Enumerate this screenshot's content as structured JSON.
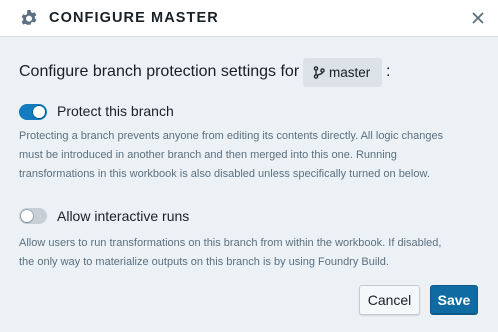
{
  "header": {
    "title": "CONFIGURE MASTER",
    "icon": "gear-icon",
    "close_icon": "close-icon"
  },
  "heading": {
    "text": "Configure branch protection settings for",
    "branch": "master",
    "branch_icon": "git-branch-icon",
    "suffix": ":"
  },
  "protect": {
    "label": "Protect this branch",
    "enabled": true,
    "description_lines": [
      "Protecting a branch prevents anyone from editing its contents directly. All logic changes",
      "must be introduced in another branch and then merged into this one. Running",
      "transformations in this workbook is also disabled unless specifically turned on below."
    ]
  },
  "interactive": {
    "label": "Allow interactive runs",
    "enabled": false,
    "description_lines": [
      "Allow users to run transformations on this branch from within the workbook. If disabled,",
      "the only way to materialize outputs on this branch is by using Foundry Build."
    ]
  },
  "footer": {
    "cancel_label": "Cancel",
    "save_label": "Save"
  },
  "colors": {
    "accent": "#137cbd",
    "primary_button": "#106ba3",
    "background": "#ebf1f5"
  }
}
